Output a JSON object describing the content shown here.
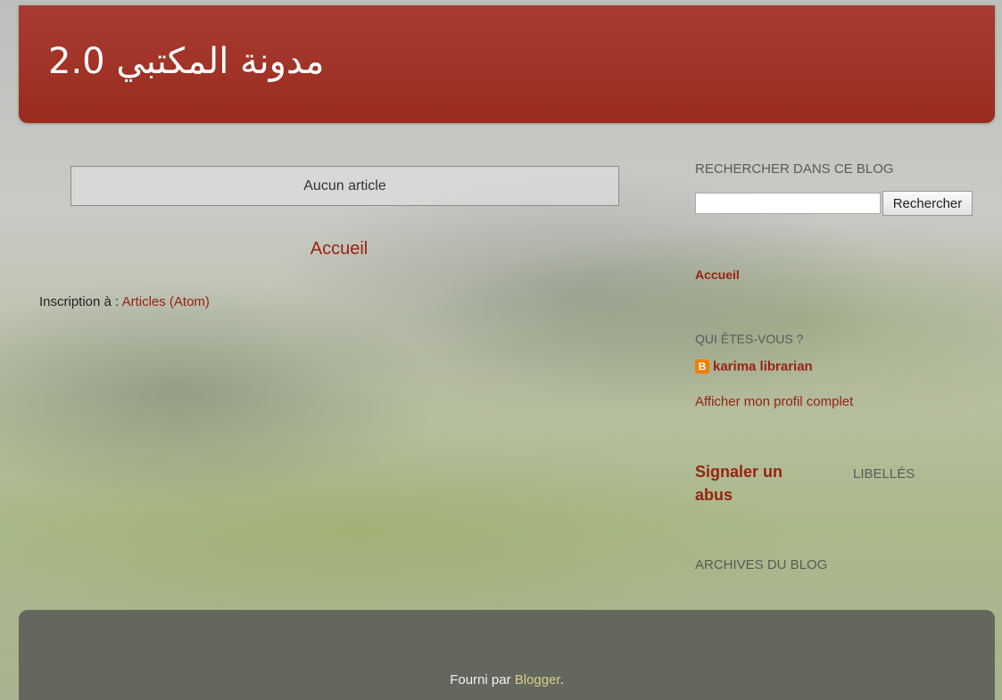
{
  "header": {
    "title": "مدونة المكتبي 2.0"
  },
  "main": {
    "no_posts": "Aucun article",
    "home_link": "Accueil",
    "subscribe_label": "Inscription à : ",
    "subscribe_link": "Articles (Atom)"
  },
  "sidebar": {
    "search_title": "RECHERCHER DANS CE BLOG",
    "search_value": "",
    "search_button": "Rechercher",
    "home_link": "Accueil",
    "profile_title": "QUI ÊTES-VOUS ?",
    "profile_icon": "blogger-icon",
    "profile_name": "karima librarian",
    "profile_full_link": "Afficher mon profil complet",
    "report_abuse": "Signaler un abus",
    "labels_title": "LIBELLÉS",
    "archive_title": "ARCHIVES DU BLOG"
  },
  "footer": {
    "powered_by": "Fourni par ",
    "blogger_link": "Blogger",
    "period": "."
  },
  "colors": {
    "header_bg": "#9a2b1e",
    "link": "#992211",
    "footer_link": "#d8cf8c"
  }
}
